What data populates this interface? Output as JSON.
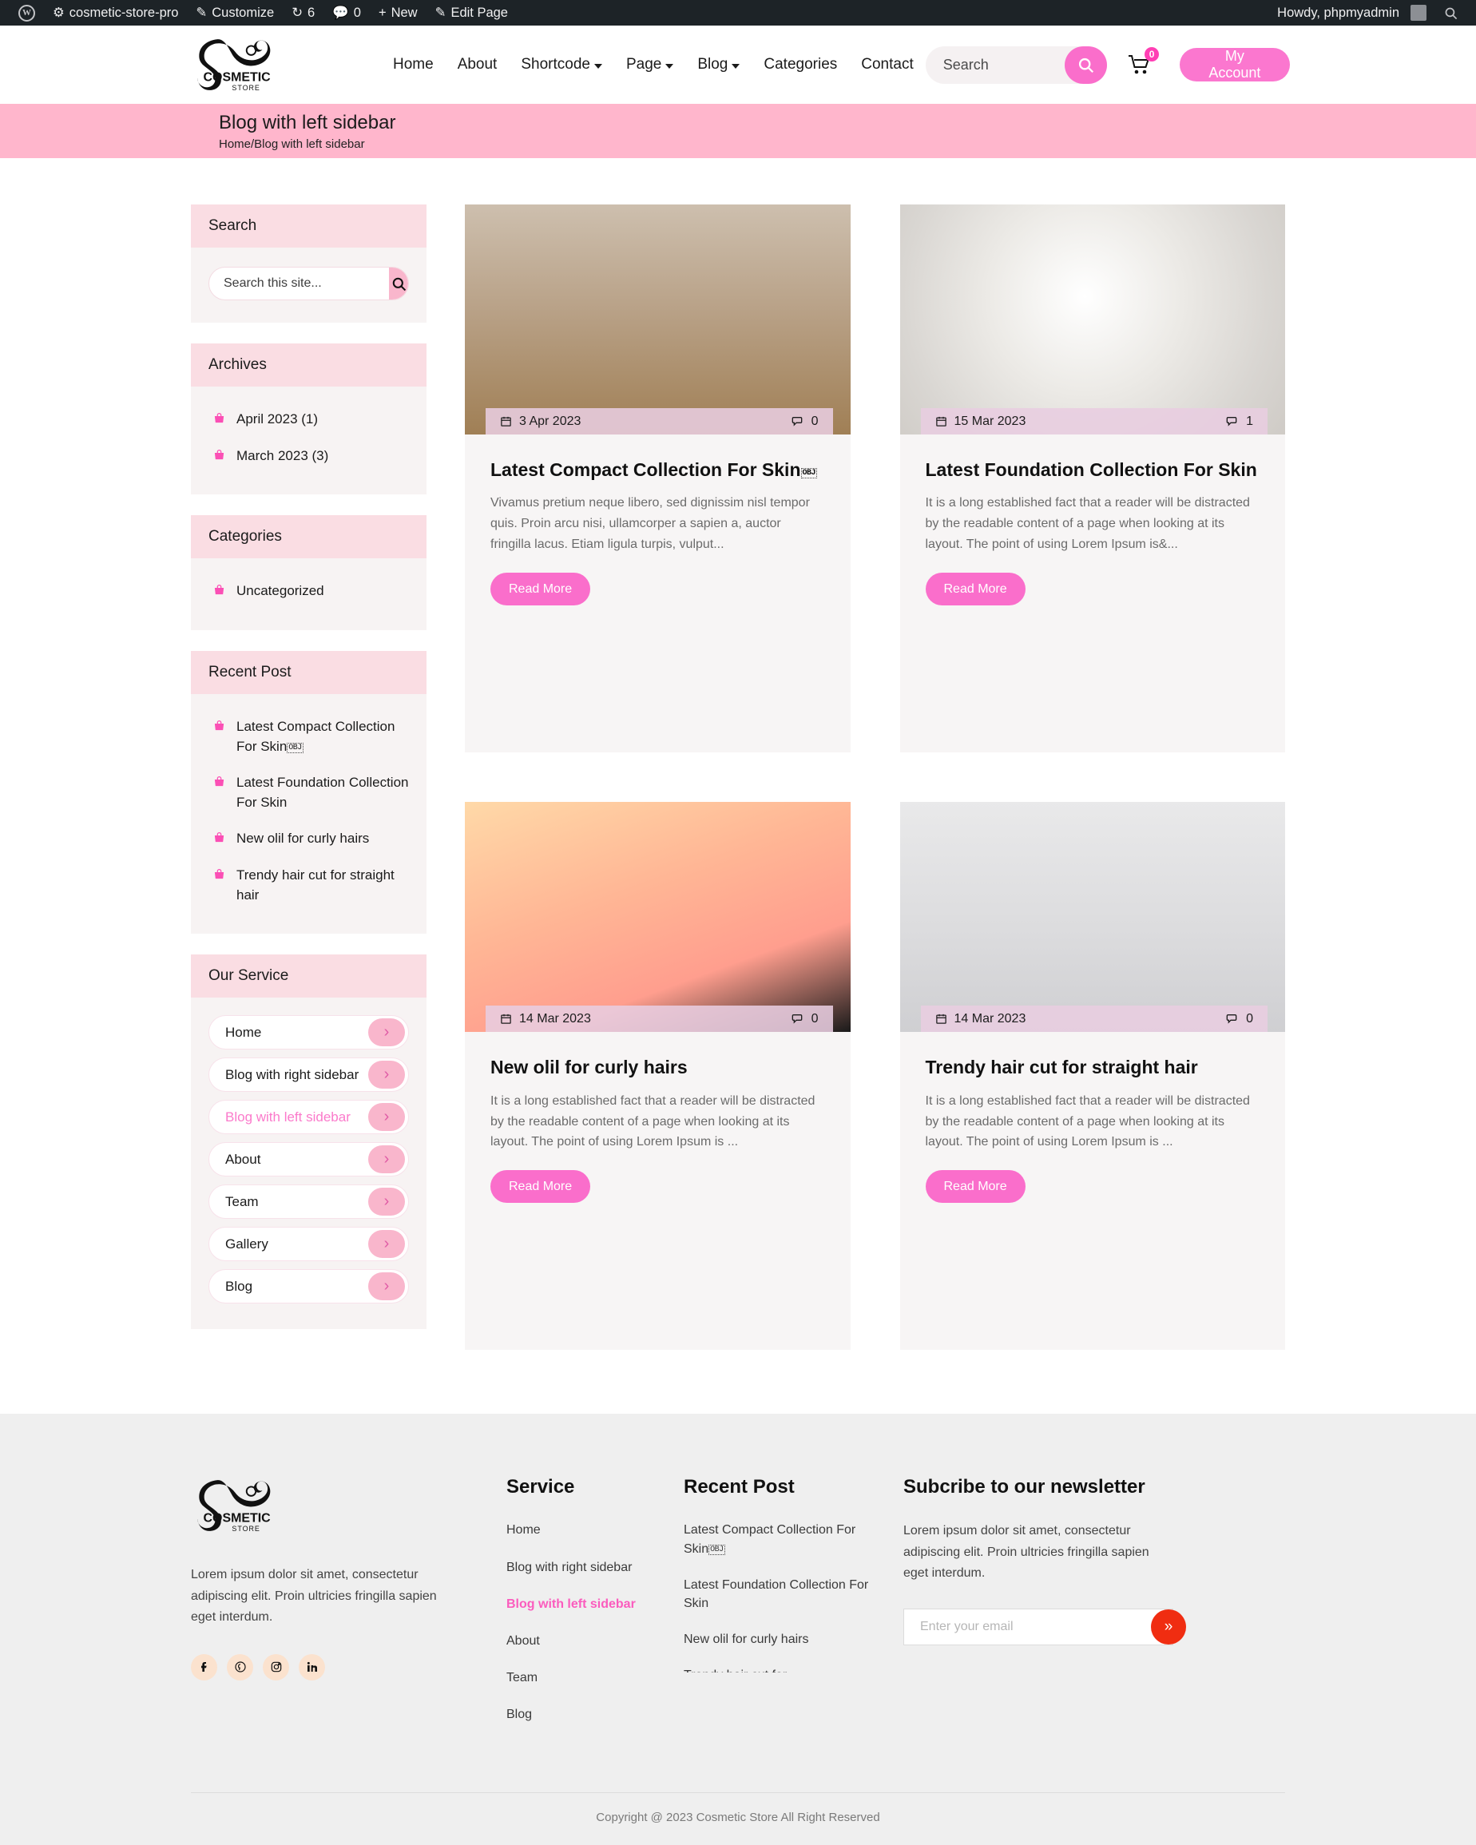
{
  "adminbar": {
    "site_name": "cosmetic-store-pro",
    "customize": "Customize",
    "updates_count": "6",
    "comments_count": "0",
    "new": "New",
    "edit_page": "Edit Page",
    "howdy": "Howdy, phpmyadmin"
  },
  "header": {
    "logo_main": "COSMETIC",
    "logo_sub": "STORE",
    "nav": [
      {
        "label": "Home",
        "caret": false
      },
      {
        "label": "About",
        "caret": false
      },
      {
        "label": "Shortcode",
        "caret": true
      },
      {
        "label": "Page",
        "caret": true
      },
      {
        "label": "Blog",
        "caret": true
      },
      {
        "label": "Categories",
        "caret": false
      },
      {
        "label": "Contact",
        "caret": false
      }
    ],
    "search_placeholder": "Search",
    "search_value": "",
    "cart_count": "0",
    "account_label": "My Account"
  },
  "banner": {
    "title": "Blog with left sidebar",
    "breadcrumb": "Home/Blog with left sidebar"
  },
  "sidebar": {
    "search": {
      "title": "Search",
      "placeholder": "Search this site...",
      "value": ""
    },
    "archives": {
      "title": "Archives",
      "items": [
        "April 2023 (1)",
        "March 2023 (3)"
      ]
    },
    "categories": {
      "title": "Categories",
      "items": [
        "Uncategorized"
      ]
    },
    "recent": {
      "title": "Recent Post",
      "items": [
        "Latest Compact Collection For Skin",
        "Latest Foundation Collection For Skin",
        "New olil for curly hairs",
        "Trendy hair cut for straight hair"
      ],
      "first_item_suffix": "OBJ"
    },
    "service": {
      "title": "Our Service",
      "items": [
        {
          "label": "Home",
          "active": false
        },
        {
          "label": "Blog with right sidebar",
          "active": false
        },
        {
          "label": "Blog with left sidebar",
          "active": true
        },
        {
          "label": "About",
          "active": false
        },
        {
          "label": "Team",
          "active": false
        },
        {
          "label": "Gallery",
          "active": false
        },
        {
          "label": "Blog",
          "active": false
        }
      ]
    }
  },
  "posts": [
    {
      "date": "3 Apr 2023",
      "comments": "0",
      "title": "Latest Compact Collection For Skin",
      "title_suffix": "OBJ",
      "excerpt": "Vivamus pretium neque libero, sed dignissim nisl tempor quis. Proin arcu nisi, ullamcorper a sapien a, auctor fringilla lacus. Etiam ligula turpis, vulput...",
      "button": "Read More",
      "image_alt": "coffee-cup-and-flower-vase"
    },
    {
      "date": "15 Mar 2023",
      "comments": "1",
      "title": "Latest Foundation Collection For Skin",
      "title_suffix": "",
      "excerpt": "It is a long established fact that a reader will be distracted by the readable content of a page when looking at its layout. The point of using Lorem Ipsum is&...",
      "button": "Read More",
      "image_alt": "open-cream-jar"
    },
    {
      "date": "14 Mar 2023",
      "comments": "0",
      "title": "New olil for curly hairs",
      "title_suffix": "",
      "excerpt": "It is a long established fact that a reader will be distracted by the readable content of a page when looking at its layout. The point of using Lorem Ipsum is ...",
      "button": "Read More",
      "image_alt": "pink-lipstick"
    },
    {
      "date": "14 Mar 2023",
      "comments": "0",
      "title": "Trendy hair cut for straight hair",
      "title_suffix": "",
      "excerpt": "It is a long established fact that a reader will be distracted by the readable content of a page when looking at its layout. The point of using Lorem Ipsum is ...",
      "button": "Read More",
      "image_alt": "lipstick-palette-case"
    }
  ],
  "footer": {
    "logo_main": "COSMETIC",
    "logo_sub": "STORE",
    "about": "Lorem ipsum dolor sit amet, consectetur adipiscing elit. Proin ultricies fringilla sapien eget interdum.",
    "socials": [
      "facebook-icon",
      "pinterest-icon",
      "instagram-icon",
      "linkedin-icon"
    ],
    "service": {
      "title": "Service",
      "items": [
        {
          "label": "Home",
          "active": false
        },
        {
          "label": "Blog with right sidebar",
          "active": false
        },
        {
          "label": "Blog with left sidebar",
          "active": true
        },
        {
          "label": "About",
          "active": false
        },
        {
          "label": "Team",
          "active": false
        },
        {
          "label": "Blog",
          "active": false
        }
      ]
    },
    "recent": {
      "title": "Recent Post",
      "items": [
        "Latest Compact Collection For Skin",
        "Latest Foundation Collection For Skin",
        "New olil for curly hairs",
        "Trendy hair cut for"
      ],
      "first_item_suffix": "OBJ"
    },
    "newsletter": {
      "title": "Subcribe to our newsletter",
      "desc": "Lorem ipsum dolor sit amet, consectetur adipiscing elit. Proin ultricies fringilla sapien eget interdum.",
      "placeholder": "Enter your email",
      "value": "",
      "submit_icon": "double-chevron-right-icon"
    },
    "copyright": "Copyright @ 2023 Cosmetic Store All Right Reserved"
  },
  "colors": {
    "accent_pink": "#FA6ECB",
    "banner_pink": "#FFB6CC",
    "widget_head": "#FADDE3",
    "widget_body": "#F7F3F3",
    "card_bg": "#F7F5F5",
    "footer_bg": "#EFEFEF",
    "newsletter_btn": "#F02D11"
  }
}
